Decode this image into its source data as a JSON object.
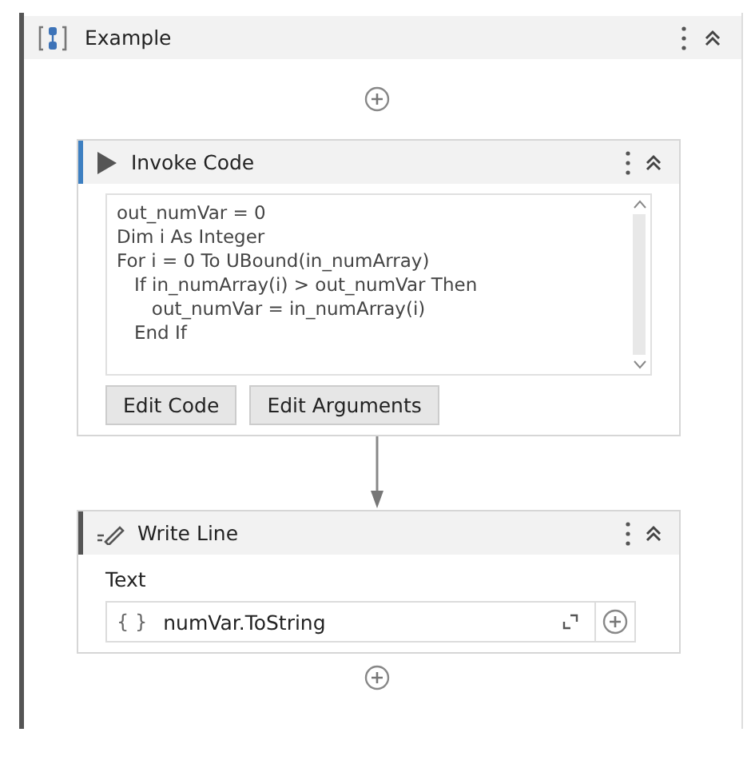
{
  "sequence": {
    "title": "Example"
  },
  "activities": [
    {
      "kind": "invoke_code",
      "title": "Invoke Code",
      "selected": true,
      "code_lines": [
        "out_numVar = 0",
        "Dim i As Integer",
        "For i = 0 To UBound(in_numArray)",
        "   If in_numArray(i) > out_numVar Then",
        "      out_numVar = in_numArray(i)",
        "   End If"
      ],
      "buttons": [
        "Edit Code",
        "Edit Arguments"
      ]
    },
    {
      "kind": "write_line",
      "title": "Write Line",
      "selected": false,
      "field_label": "Text",
      "field_prefix": "{ }",
      "field_value": "numVar.ToString"
    }
  ]
}
